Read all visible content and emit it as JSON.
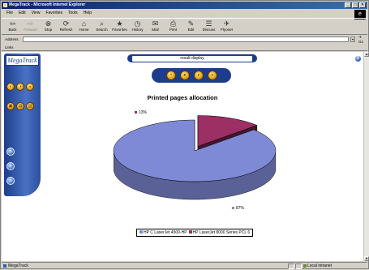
{
  "window": {
    "title": "MegaTrack - Microsoft Internet Explorer",
    "controls": [
      "_",
      "□",
      "×"
    ]
  },
  "menu": [
    "File",
    "Edit",
    "View",
    "Favorites",
    "Tools",
    "Help"
  ],
  "toolbar": [
    {
      "label": "Back",
      "icon": "back-arrow-icon",
      "glyph": "⇦",
      "enabled": true
    },
    {
      "label": "Forward",
      "icon": "forward-arrow-icon",
      "glyph": "⇨",
      "enabled": false
    },
    {
      "label": "Stop",
      "icon": "stop-icon",
      "glyph": "⊗",
      "enabled": true
    },
    {
      "label": "Refresh",
      "icon": "refresh-icon",
      "glyph": "⟳",
      "enabled": true
    },
    {
      "label": "Home",
      "icon": "home-icon",
      "glyph": "⌂",
      "enabled": true
    },
    {
      "label": "Search",
      "icon": "search-icon",
      "glyph": "⌕",
      "enabled": true
    },
    {
      "label": "Favorites",
      "icon": "favorites-icon",
      "glyph": "★",
      "enabled": true
    },
    {
      "label": "History",
      "icon": "history-icon",
      "glyph": "◷",
      "enabled": true
    },
    {
      "label": "Mail",
      "icon": "mail-icon",
      "glyph": "✉",
      "enabled": true
    },
    {
      "label": "Print",
      "icon": "print-icon",
      "glyph": "⎙",
      "enabled": true
    },
    {
      "label": "Edit",
      "icon": "edit-icon",
      "glyph": "✎",
      "enabled": true
    },
    {
      "label": "Discuss",
      "icon": "discuss-icon",
      "glyph": "☰",
      "enabled": true
    },
    {
      "label": "Flyonet",
      "icon": "flyonet-icon",
      "glyph": "✈",
      "enabled": true
    }
  ],
  "address": {
    "label": "Address",
    "value": "",
    "go": "Go"
  },
  "links": {
    "label": "Links"
  },
  "page": {
    "brand": "MegaTrack",
    "display_label": "result display",
    "nav_top": [
      "◐",
      "◑",
      "◒"
    ],
    "nav_mid": [
      "▣",
      "▤",
      "▥"
    ],
    "view_buttons": [
      "◔",
      "◕",
      "◖",
      "◗"
    ],
    "side_circles": [
      "›",
      "›",
      "›"
    ],
    "help_glyph": "?"
  },
  "chart_data": {
    "type": "pie",
    "title": "Printed pages allocation",
    "slices": [
      {
        "name": "HP C LaserJet 4500-HP",
        "value": 87,
        "label": "87%",
        "color": "#7f8ad6"
      },
      {
        "name": "HP LaserJet 8000 Series PCL 6",
        "value": 13,
        "label": "13%",
        "color": "#9c2f64"
      }
    ],
    "legend_position": "bottom"
  },
  "status": {
    "text": "MegaTrack",
    "zone": "Local intranet"
  }
}
